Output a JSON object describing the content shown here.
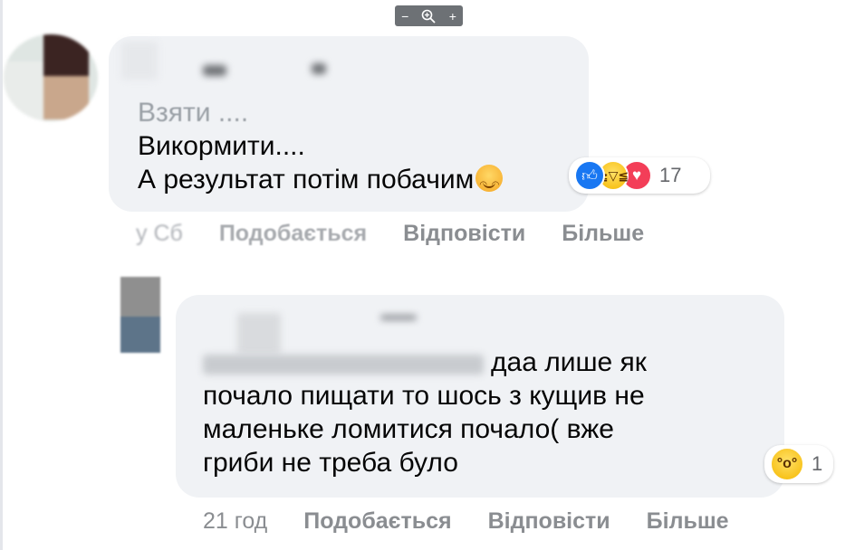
{
  "zoom": {
    "minus": "−",
    "plus": "+",
    "icon": "zoom-in-icon"
  },
  "comment1": {
    "author_blurred": true,
    "lines": [
      "Взяти ....",
      "Викормити....",
      "А результат потім побачим"
    ],
    "emoji": "smiling-face-icon",
    "reactions": {
      "icons": [
        "like-icon",
        "haha-icon",
        "love-icon"
      ],
      "count": "17"
    },
    "timestamp": "у Сб",
    "like_label": "Подобається",
    "reply_label": "Відповісти",
    "more_label": "Більше"
  },
  "comment2": {
    "author_blurred": true,
    "lines": [
      "даа лише як",
      "почало пищати то шось з кущив не",
      "маленьке ломитися почало( вже",
      "гриби не треба було"
    ],
    "reactions": {
      "icons": [
        "wow-icon"
      ],
      "count": "1"
    },
    "timestamp": "21 год",
    "like_label": "Подобається",
    "reply_label": "Відповісти",
    "more_label": "Більше"
  },
  "colors": {
    "bubble": "#f0f2f5",
    "meta": "#8a8d91",
    "like": "#1877f2",
    "love": "#f33e58"
  }
}
